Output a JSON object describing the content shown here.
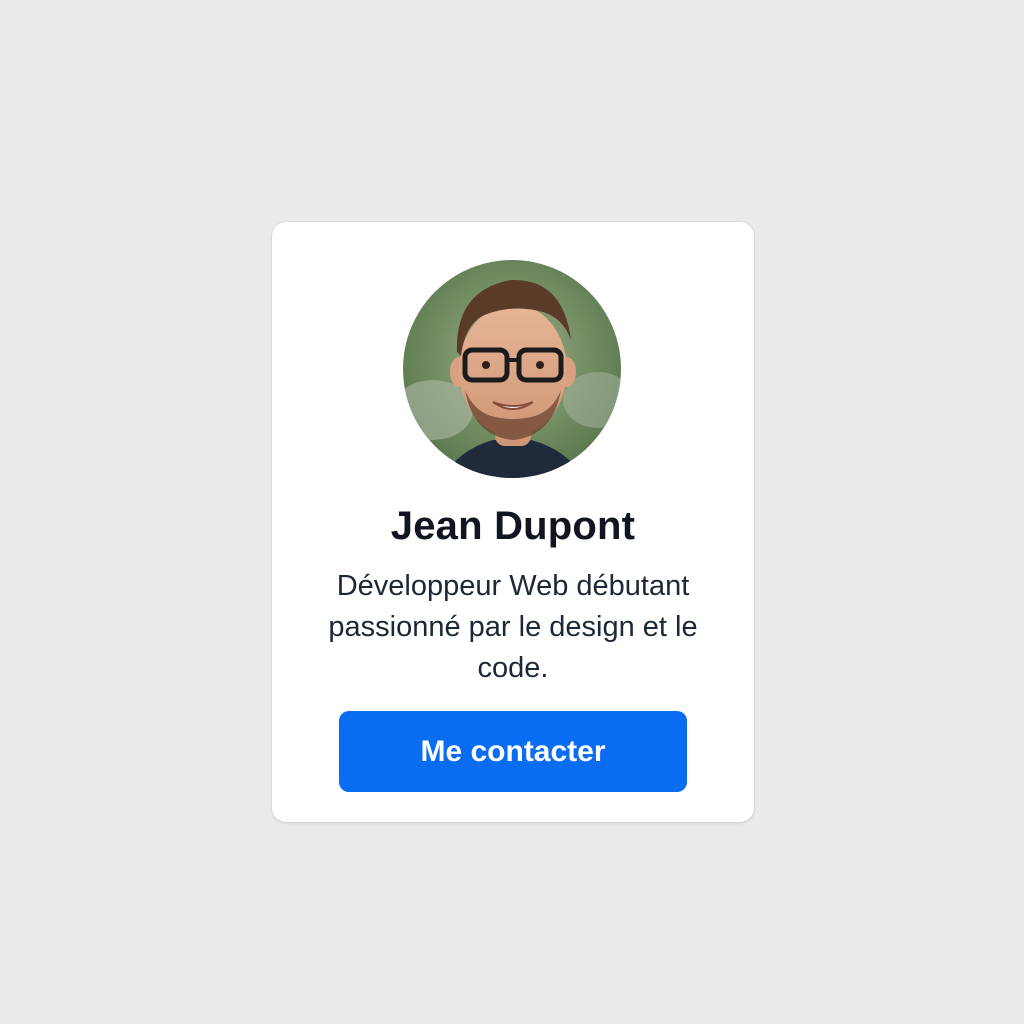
{
  "profile": {
    "name": "Jean Dupont",
    "bio": "Développeur Web débutant passionné par le design et le code.",
    "avatar_alt": "Jean Dupont"
  },
  "actions": {
    "contact_label": "Me contacter"
  },
  "colors": {
    "page_background": "#e9eaec",
    "card_background": "#ffffff",
    "button": "#0a6cf0",
    "name_text": "#10151f",
    "bio_text": "#1c2737"
  }
}
